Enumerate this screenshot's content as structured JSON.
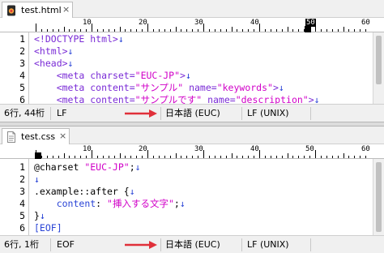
{
  "colors": {
    "tag": "#7a2bd6",
    "string": "#d100c8",
    "eol_marker": "#2a44d6",
    "arrow": "#e0303a",
    "ruler_cursor": "#000000"
  },
  "top_pane": {
    "tab": {
      "label": "test.html",
      "icon": "html-file-icon",
      "close_glyph": "×"
    },
    "ruler": {
      "labels": [
        "10",
        "20",
        "30",
        "40",
        "50",
        "60"
      ],
      "highlighted": "50"
    },
    "lines": {
      "numbers": [
        "1",
        "2",
        "3",
        "4",
        "5",
        "6"
      ],
      "l1": {
        "text": "<!DOCTYPE html>",
        "eol": "↓"
      },
      "l2": {
        "text": "<html>",
        "eol": "↓"
      },
      "l3": {
        "text": "<head>",
        "eol": "↓"
      },
      "l4": {
        "indent": "    ",
        "open": "<meta ",
        "attr1": "charset=",
        "val1": "\"EUC-JP\"",
        "close": ">",
        "eol": "↓"
      },
      "l5": {
        "indent": "    ",
        "open": "<meta ",
        "attr1": "content=",
        "val1": "\"サンプル\"",
        "attr2": " name=",
        "val2": "\"keywords\"",
        "close": ">",
        "eol": "↓"
      },
      "l6": {
        "indent": "    ",
        "open": "<meta ",
        "attr1": "content=",
        "val1": "\"サンプルです\"",
        "attr2": " name=",
        "val2": "\"description\"",
        "close": ">",
        "eol": "↓"
      }
    },
    "status": {
      "position": "6行, 44桁",
      "line_ending": "LF",
      "encoding": "日本語 (EUC)",
      "line_ending_type": "LF (UNIX)"
    }
  },
  "bottom_pane": {
    "tab": {
      "label": "test.css",
      "icon": "css-file-icon",
      "close_glyph": "×"
    },
    "ruler": {
      "labels": [
        "10",
        "20",
        "30",
        "40",
        "50",
        "60"
      ],
      "highlighted": ""
    },
    "lines": {
      "numbers": [
        "1",
        "2",
        "3",
        "4",
        "5",
        "6"
      ],
      "l1": {
        "key": "@charset ",
        "val": "\"EUC-JP\"",
        "end": ";",
        "eol": "↓"
      },
      "l2": {
        "eol": "↓"
      },
      "l3": {
        "key": ".example::after {",
        "eol": "↓"
      },
      "l4": {
        "indent": "    ",
        "prop": "content",
        "colon": ": ",
        "val": "\"挿入する文字\"",
        "end": ";",
        "eol": "↓"
      },
      "l5": {
        "key": "}",
        "eol": "↓"
      },
      "l6": {
        "eof": "[EOF]"
      }
    },
    "status": {
      "position": "6行, 1桁",
      "line_ending": "EOF",
      "encoding": "日本語 (EUC)",
      "line_ending_type": "LF (UNIX)"
    }
  }
}
